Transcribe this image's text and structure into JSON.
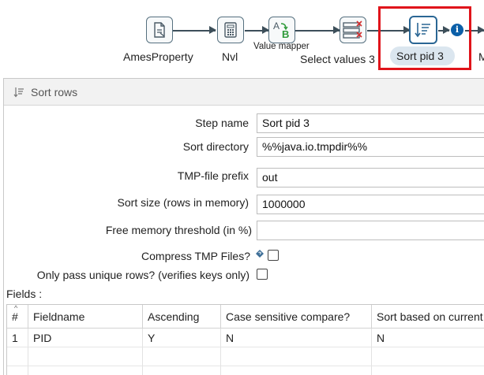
{
  "pipeline": {
    "steps": [
      {
        "label": "AmesProperty",
        "icon": "file-input-icon"
      },
      {
        "label": "Nvl",
        "icon": "calculator-icon"
      },
      {
        "label": "Value mapper",
        "icon": "value-mapper-icon"
      },
      {
        "label": "Select values 3",
        "icon": "select-values-icon"
      },
      {
        "label": "Sort pid 3",
        "icon": "sort-rows-icon",
        "selected": true
      },
      {
        "label": "M",
        "icon": ""
      }
    ],
    "info_icon_glyph": "i",
    "highlight_color": "#e0141b"
  },
  "dialog": {
    "title": "Sort rows",
    "step_name_label": "Step name",
    "step_name_value": "Sort pid 3",
    "sort_directory_label": "Sort directory",
    "sort_directory_value": "%%java.io.tmpdir%%",
    "tmp_prefix_label": "TMP-file prefix",
    "tmp_prefix_value": "out",
    "sort_size_label": "Sort size (rows in memory)",
    "sort_size_value": "1000000",
    "free_memory_label": "Free memory threshold (in %)",
    "free_memory_value": "",
    "compress_label": "Compress TMP Files?",
    "compress_checked": false,
    "unique_label": "Only pass unique rows? (verifies keys only)",
    "unique_checked": false,
    "fields_label": "Fields :"
  },
  "fields_table": {
    "columns": [
      "#",
      "Fieldname",
      "Ascending",
      "Case sensitive compare?",
      "Sort based on current"
    ],
    "rows": [
      [
        "1",
        "PID",
        "Y",
        "N",
        "N"
      ]
    ]
  }
}
